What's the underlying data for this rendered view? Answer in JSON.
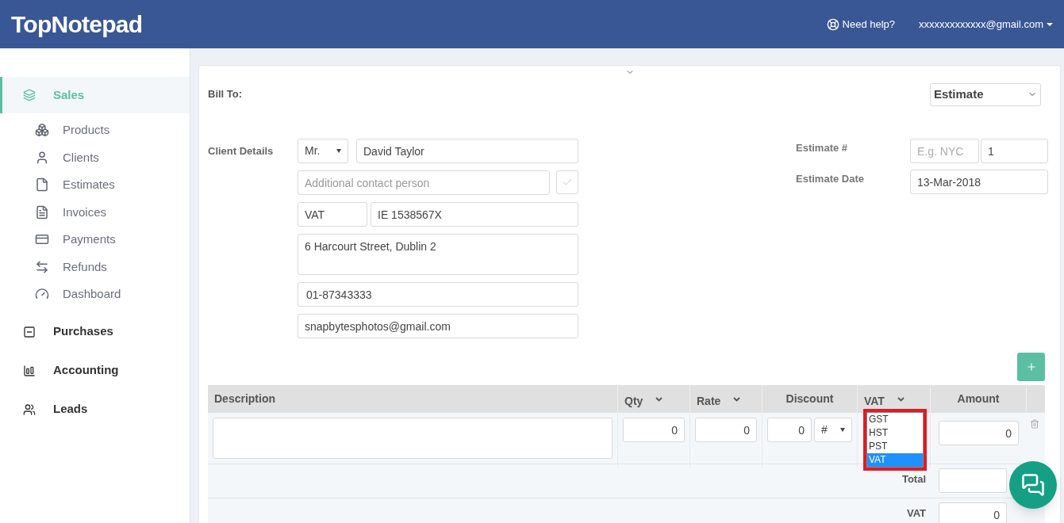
{
  "header": {
    "logo": "TopNotepad",
    "help": "Need help?",
    "account": "xxxxxxxxxxxxx@gmail.com"
  },
  "sidebar": {
    "sections": [
      {
        "label": "Sales",
        "selected": true,
        "expanded": true,
        "children": [
          {
            "label": "Products"
          },
          {
            "label": "Clients"
          },
          {
            "label": "Estimates"
          },
          {
            "label": "Invoices"
          },
          {
            "label": "Payments"
          },
          {
            "label": "Refunds"
          },
          {
            "label": "Dashboard"
          }
        ]
      },
      {
        "label": "Purchases",
        "selected": false,
        "expanded": false
      },
      {
        "label": "Accounting",
        "selected": false,
        "expanded": false
      },
      {
        "label": "Leads",
        "selected": false,
        "expanded": false
      }
    ]
  },
  "bill_to_label": "Bill To:",
  "document_type": "Estimate",
  "client": {
    "label": "Client Details",
    "salutation": "Mr.",
    "name": "David Taylor",
    "contact_placeholder": "Additional contact person",
    "contact_checked": false,
    "tax_label": "VAT",
    "tax_id": "IE 1538567X",
    "address": "6 Harcourt Street, Dublin 2",
    "phone": "01-87343333",
    "email": "snapbytesphotos@gmail.com"
  },
  "estimate": {
    "number_label": "Estimate #",
    "prefix_placeholder": "E.g. NYC",
    "number": "1",
    "date_label": "Estimate Date",
    "date": "13-Mar-2018"
  },
  "table": {
    "columns": [
      {
        "label": "Description",
        "kind": "text"
      },
      {
        "label": "Qty",
        "kind": "menu"
      },
      {
        "label": "Rate",
        "kind": "menu"
      },
      {
        "label": "Discount",
        "kind": "centered"
      },
      {
        "label": "VAT",
        "kind": "menu"
      },
      {
        "label": "Amount",
        "kind": "centered"
      }
    ],
    "rows": [
      {
        "qty": "0",
        "rate": "0",
        "discount": "0",
        "discount_type": "#",
        "amount": "0"
      }
    ]
  },
  "tax_dropdown": {
    "options": [
      {
        "label": "GST",
        "selected": false
      },
      {
        "label": "HST",
        "selected": false
      },
      {
        "label": "PST",
        "selected": false
      },
      {
        "label": "VAT",
        "selected": true
      }
    ]
  },
  "totals": [
    {
      "label": "Total"
    },
    {
      "label": "VAT",
      "value": "0"
    }
  ]
}
